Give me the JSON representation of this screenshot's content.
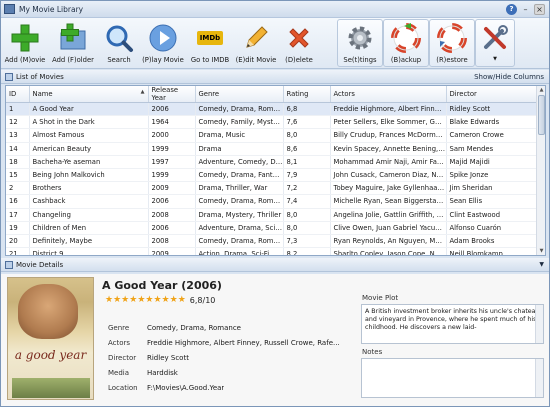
{
  "window": {
    "title": "My Movie Library"
  },
  "toolbar": {
    "buttons": [
      {
        "label": "Add (M)ovie",
        "icon": "plus-icon"
      },
      {
        "label": "Add (F)older",
        "icon": "add-folder-icon"
      },
      {
        "label": "Search",
        "icon": "search-icon"
      },
      {
        "label": "(P)lay Movie",
        "icon": "play-icon"
      },
      {
        "label": "Go to IMDB",
        "icon": "imdb-icon",
        "icon_text": "IMDb"
      },
      {
        "label": "(E)dit Movie",
        "icon": "pencil-icon"
      },
      {
        "label": "(D)elete",
        "icon": "delete-icon"
      },
      {
        "label": "Se(t)tings",
        "icon": "gear-icon"
      },
      {
        "label": "(B)ackup",
        "icon": "backup-icon"
      },
      {
        "label": "(R)estore",
        "icon": "restore-icon"
      },
      {
        "label": "",
        "icon": "tools-icon"
      }
    ]
  },
  "list_panel": {
    "title": "List of Movies",
    "show_hide": "Show/Hide Columns"
  },
  "table": {
    "columns": [
      "ID",
      "Name",
      "Release Year",
      "Genre",
      "Rating",
      "Actors",
      "Director"
    ],
    "rows": [
      [
        "1",
        "A Good Year",
        "2006",
        "Comedy, Drama, Roma...",
        "6,8",
        "Freddie Highmore, Albert Finney, ...",
        "Ridley Scott"
      ],
      [
        "12",
        "A Shot in the Dark",
        "1964",
        "Comedy, Family, Mystery",
        "7,6",
        "Peter Sellers, Elke Sommer, Georg...",
        "Blake Edwards"
      ],
      [
        "13",
        "Almost Famous",
        "2000",
        "Drama, Music",
        "8,0",
        "Billy Crudup, Frances McDorman...",
        "Cameron Crowe"
      ],
      [
        "14",
        "American Beauty",
        "1999",
        "Drama",
        "8,6",
        "Kevin Spacey, Annette Bening, Th...",
        "Sam Mendes"
      ],
      [
        "18",
        "Bacheha-Ye aseman",
        "1997",
        "Adventure, Comedy, Dr...",
        "8,1",
        "Mohammad Amir Naji, Amir Farr...",
        "Majid Majidi"
      ],
      [
        "15",
        "Being John Malkovich",
        "1999",
        "Comedy, Drama, Fantas...",
        "7,9",
        "John Cusack, Cameron Diaz, Ned ...",
        "Spike Jonze"
      ],
      [
        "2",
        "Brothers",
        "2009",
        "Drama, Thriller, War",
        "7,2",
        "Tobey Maguire, Jake Gyllenhaal, ...",
        "Jim Sheridan"
      ],
      [
        "16",
        "Cashback",
        "2006",
        "Comedy, Drama, Roma...",
        "7,4",
        "Michelle Ryan, Sean Biggerstaff, E...",
        "Sean Ellis"
      ],
      [
        "17",
        "Changeling",
        "2008",
        "Drama, Mystery, Thriller",
        "8,0",
        "Angelina Jolie, Gattlin Griffith, Mi...",
        "Clint Eastwood"
      ],
      [
        "19",
        "Children of Men",
        "2006",
        "Adventure, Drama, Sci-F...",
        "8,0",
        "Clive Owen, Juan Gabriel Yacuzzi, ...",
        "Alfonso Cuarón"
      ],
      [
        "20",
        "Definitely, Maybe",
        "2008",
        "Comedy, Drama, Roma...",
        "7,3",
        "Ryan Reynolds, An Nguyen, Matt...",
        "Adam Brooks"
      ],
      [
        "21",
        "District 9",
        "2009",
        "Action, Drama, Sci-Fi, T...",
        "8,2",
        "Sharlto Copley, Jason Cope, Nath...",
        "Neill Blomkamp"
      ]
    ]
  },
  "details_panel": {
    "title": "Movie Details"
  },
  "details": {
    "title": "A Good Year (2006)",
    "rating": "6,8/10",
    "stars_filled": 10,
    "poster_title": "a good year",
    "labels": {
      "genre": "Genre",
      "actors": "Actors",
      "director": "Director",
      "media": "Media",
      "location": "Location"
    },
    "genre": "Comedy, Drama, Romance",
    "actors": "Freddie Highmore, Albert Finney, Russell Crowe, Rafe...",
    "director": "Ridley Scott",
    "media": "Harddisk",
    "location": "F:\\Movies\\A.Good.Year",
    "plot_label": "Movie Plot",
    "plot": "A British investment broker inherits his uncle's chateau and vineyard in Provence, where he spent much of his childhood. He discovers a new laid-",
    "notes_label": "Notes",
    "notes": ""
  },
  "colors": {
    "accent": "#3d6fb8",
    "selection": "#dfe8f6",
    "star": "#f0a318"
  }
}
